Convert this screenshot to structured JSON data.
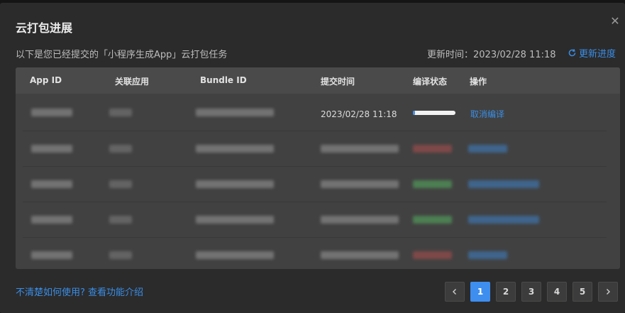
{
  "dialog": {
    "title": "云打包进展",
    "subtitle": "以下是您已经提交的「小程序生成App」云打包任务",
    "update_time_label": "更新时间：2023/02/28 11:18",
    "refresh_label": "更新进度",
    "help_link": "不清楚如何使用? 查看功能介绍"
  },
  "table": {
    "columns": [
      "App ID",
      "关联应用",
      "Bundle ID",
      "提交时间",
      "编译状态",
      "操作"
    ],
    "rows": [
      {
        "submit_time": "2023/02/28 11:18",
        "status_progress": 0.05,
        "action": "取消编译"
      }
    ]
  },
  "pagination": {
    "pages": [
      "1",
      "2",
      "3",
      "4",
      "5"
    ],
    "active_page": "1"
  },
  "colors": {
    "accent": "#3a8ee6",
    "active_page": "#3e8ef0",
    "progress_fill": "#4a90e2"
  }
}
